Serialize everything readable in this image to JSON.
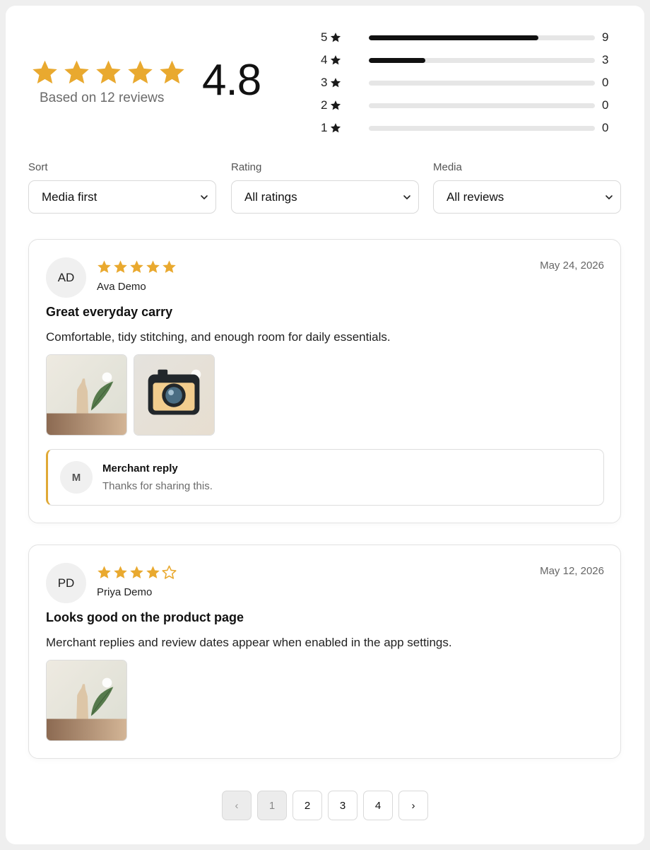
{
  "summary": {
    "average_rating": "4.8",
    "average_stars": 5,
    "based_on_text": "Based on 12 reviews",
    "distribution": [
      {
        "stars": "5",
        "count": "9",
        "fraction": 0.75
      },
      {
        "stars": "4",
        "count": "3",
        "fraction": 0.25
      },
      {
        "stars": "3",
        "count": "0",
        "fraction": 0
      },
      {
        "stars": "2",
        "count": "0",
        "fraction": 0
      },
      {
        "stars": "1",
        "count": "0",
        "fraction": 0
      }
    ]
  },
  "filters": {
    "sort": {
      "label": "Sort",
      "value": "Media first"
    },
    "rating": {
      "label": "Rating",
      "value": "All ratings"
    },
    "media": {
      "label": "Media",
      "value": "All reviews"
    }
  },
  "reviews": [
    {
      "initials": "AD",
      "name": "Ava Demo",
      "rating": 5,
      "date": "May 24, 2026",
      "title": "Great everyday carry",
      "body": "Comfortable, tidy stitching, and enough room for daily essentials.",
      "media": [
        "vase-photo",
        "camera-photo"
      ],
      "reply": {
        "initial": "M",
        "title": "Merchant reply",
        "text": "Thanks for sharing this."
      }
    },
    {
      "initials": "PD",
      "name": "Priya Demo",
      "rating": 4,
      "date": "May 12, 2026",
      "title": "Looks good on the product page",
      "body": "Merchant replies and review dates appear when enabled in the app settings.",
      "media": [
        "vase-photo"
      ]
    }
  ],
  "pagination": {
    "prev": "‹",
    "next": "›",
    "pages": [
      "1",
      "2",
      "3",
      "4"
    ],
    "current": "1"
  },
  "colors": {
    "star": "#e9a92f",
    "bar": "#111111",
    "reply_accent": "#e0a935"
  }
}
